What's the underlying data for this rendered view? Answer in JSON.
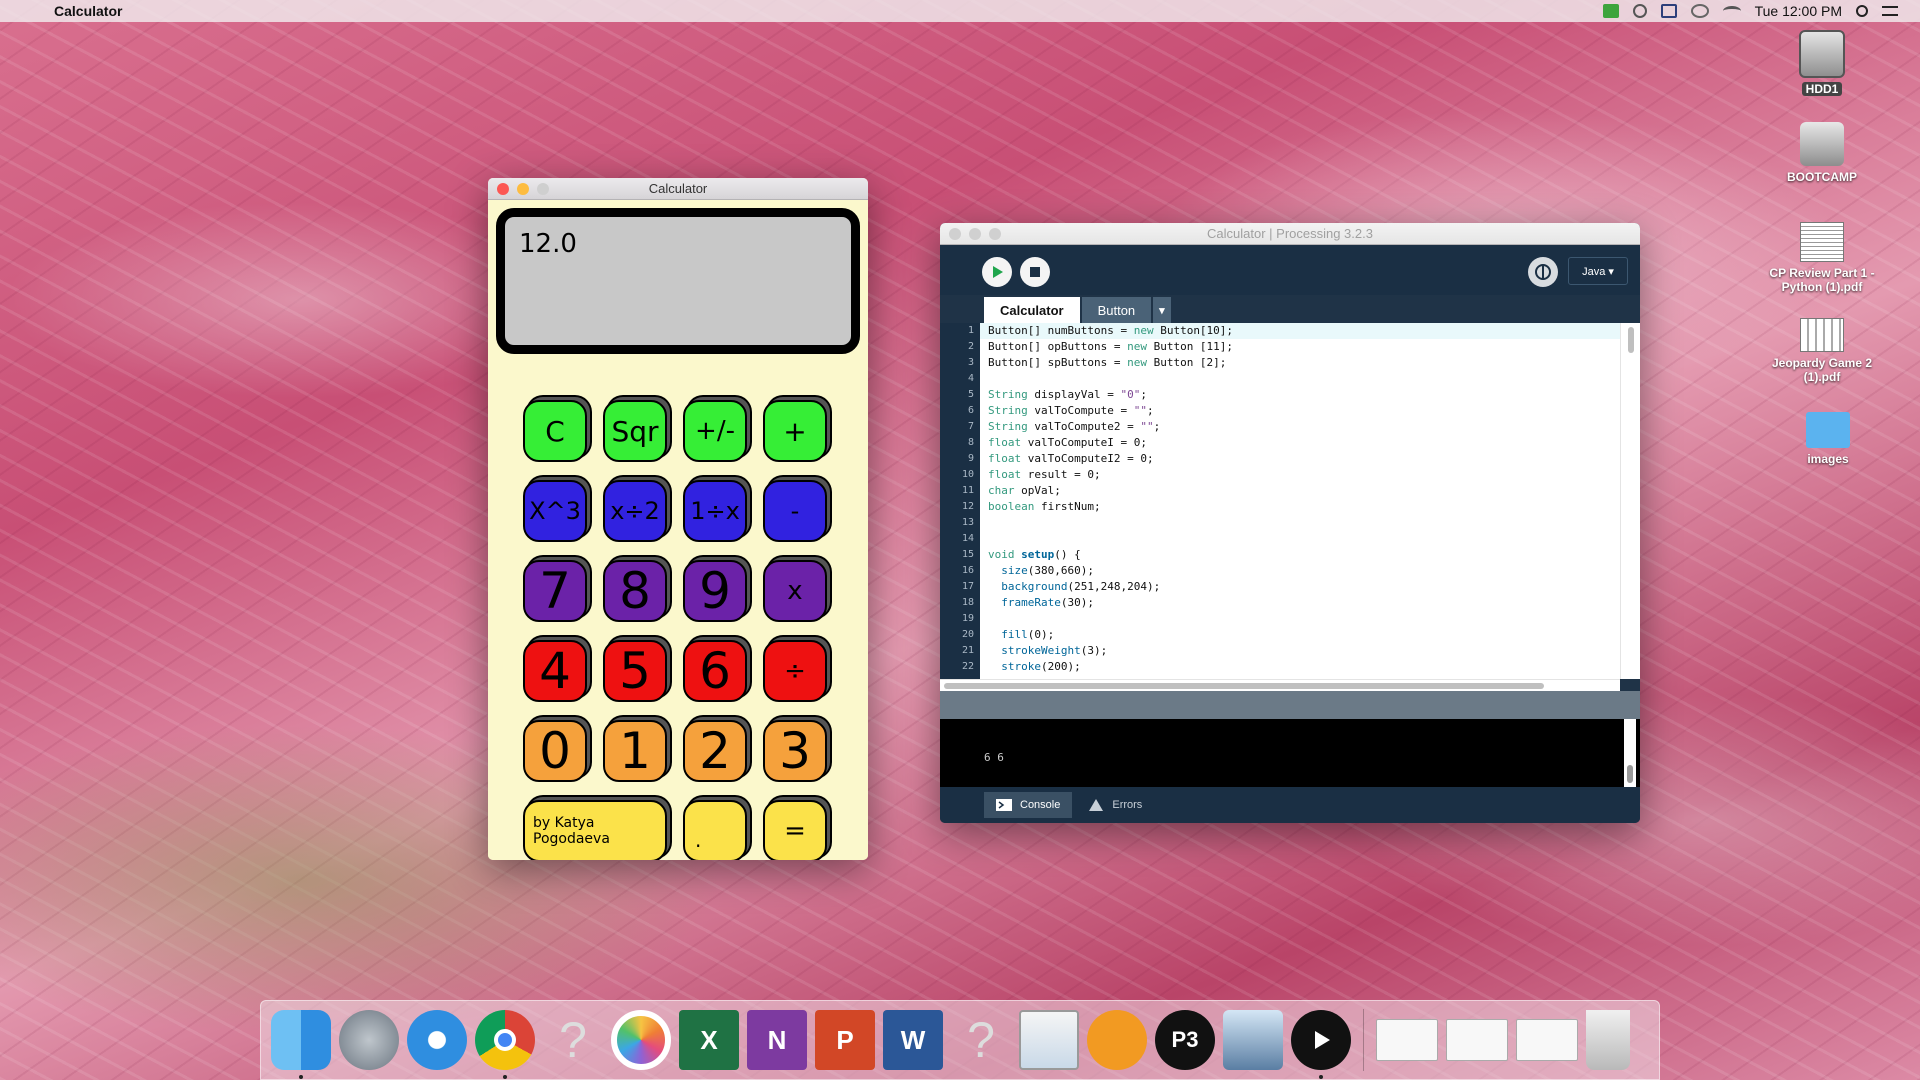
{
  "menubar": {
    "app_name": "Calculator",
    "clock": "Tue 12:00 PM"
  },
  "desktop_icons": [
    {
      "label": "HDD1",
      "type": "drive"
    },
    {
      "label": "BOOTCAMP",
      "type": "drive"
    },
    {
      "label": "CP Review Part 1 - Python (1).pdf",
      "type": "pdf"
    },
    {
      "label": "Jeopardy Game 2 (1).pdf",
      "type": "pdf"
    },
    {
      "label": "images",
      "type": "folder"
    }
  ],
  "calculator_window": {
    "title": "Calculator",
    "display_value": "12.0",
    "buttons": [
      [
        "C",
        "Sqr",
        "+/-",
        "+"
      ],
      [
        "X^3",
        "x÷2",
        "1÷x",
        "-"
      ],
      [
        "7",
        "8",
        "9",
        "x"
      ],
      [
        "4",
        "5",
        "6",
        "÷"
      ],
      [
        "0",
        "1",
        "2",
        "3"
      ],
      [
        "by Katya Pogodaeva",
        ".",
        "="
      ]
    ],
    "colors": {
      "row_green": "#36ee36",
      "row_blue": "#3122e0",
      "row_purple": "#6b22a8",
      "row_red": "#ee1111",
      "row_orange": "#f5a13c",
      "row_yellow": "#fbe24a",
      "background": "#fbf8cc"
    }
  },
  "processing_window": {
    "title": "Calculator | Processing 3.2.3",
    "mode": "Java ▾",
    "tabs": [
      "Calculator",
      "Button"
    ],
    "tab_menu": "▾",
    "line_numbers": [
      "1",
      "2",
      "3",
      "4",
      "5",
      "6",
      "7",
      "8",
      "9",
      "10",
      "11",
      "12",
      "13",
      "14",
      "15",
      "16",
      "17",
      "18",
      "19",
      "20",
      "21",
      "22"
    ],
    "console_output": "6 6",
    "footer_tabs": [
      "Console",
      "Errors"
    ]
  },
  "dock": {
    "apps": [
      "Finder",
      "Launchpad",
      "Safari",
      "Chrome",
      "?",
      "Photos",
      "Excel",
      "OneNote",
      "PowerPoint",
      "Word",
      "?",
      "Preview",
      "iBooks",
      "Processing",
      "Image Capture",
      "QuickTime"
    ],
    "letters": {
      "excel": "X",
      "onenote": "N",
      "powerpoint": "P",
      "word": "W",
      "processing": "P3"
    }
  }
}
